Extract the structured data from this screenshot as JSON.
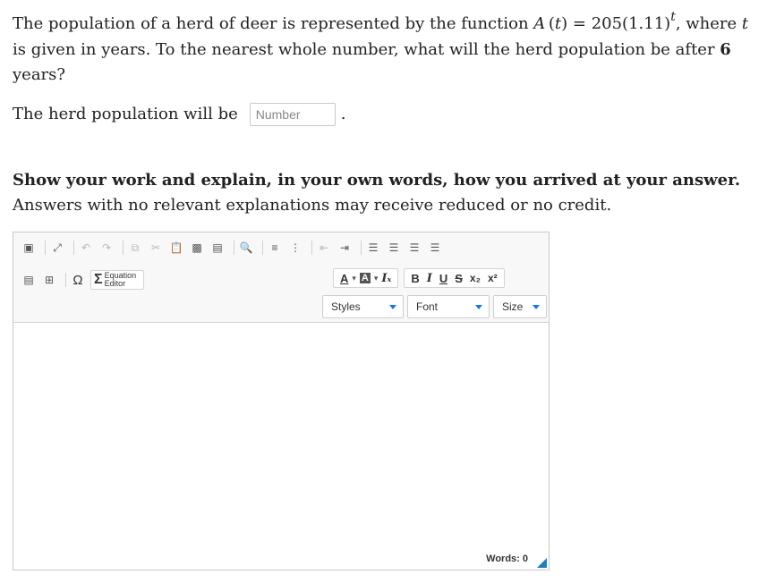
{
  "question": {
    "p1": "The population of a herd of deer is represented by the function ",
    "fn_name": "A",
    "fn_var": "t",
    "fn_rhs": "205(1.11)",
    "fn_exp": "t",
    "p2": ", where ",
    "t_var": "t",
    "p3": " is given in years. To the nearest whole number, what will the herd population be after ",
    "years": "6",
    "p4": " years?"
  },
  "answer": {
    "prefix": "The herd population will be",
    "placeholder": "Number",
    "suffix": "."
  },
  "instruction": {
    "bold": "Show your work and explain, in your own words, how you arrived at your answer.",
    "normal": " Answers with no relevant explanations may receive reduced or no credit."
  },
  "editor": {
    "equation_line1": "Equation",
    "equation_line2": "Editor",
    "styles_label": "Styles",
    "font_label": "Font",
    "size_label": "Size",
    "word_count": "Words: 0"
  }
}
